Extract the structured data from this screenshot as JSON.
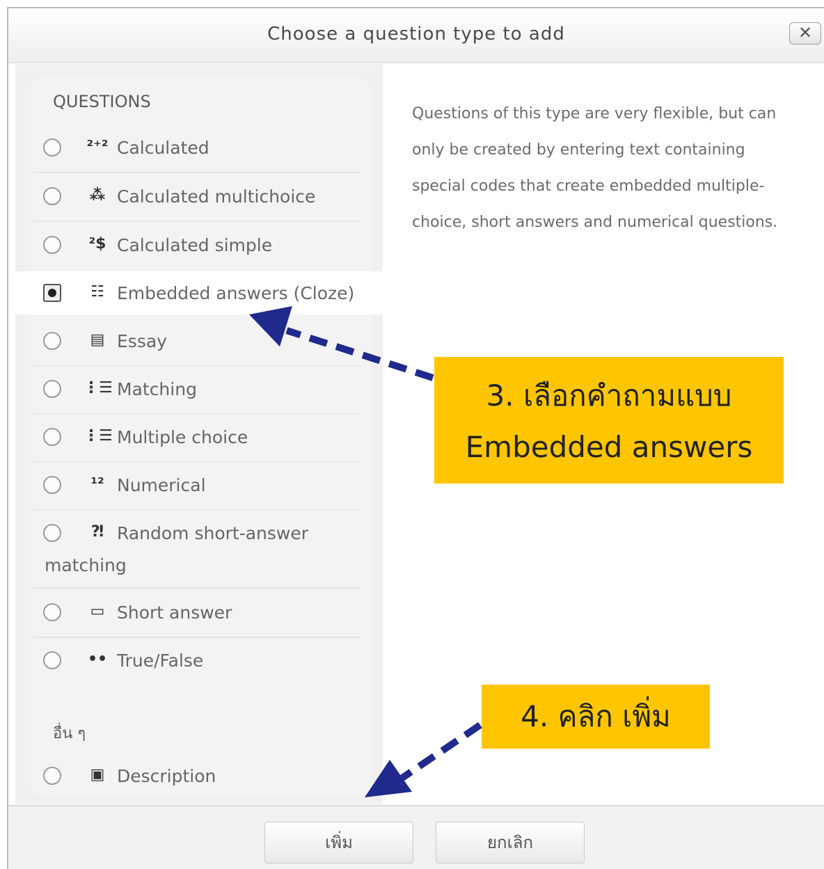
{
  "dialog": {
    "title": "Choose a question type to add",
    "close_icon": "close-icon",
    "close_glyph": "✕"
  },
  "left": {
    "section_questions": "QUESTIONS",
    "questions": [
      {
        "label": "Calculated",
        "icon": "calculated-icon",
        "glyph": "²⁺²",
        "selected": false
      },
      {
        "label": "Calculated multichoice",
        "icon": "calculated-multichoice-icon",
        "glyph": "⁂",
        "selected": false
      },
      {
        "label": "Calculated simple",
        "icon": "calculated-simple-icon",
        "glyph": "²$",
        "selected": false
      },
      {
        "label": "Embedded answers (Cloze)",
        "icon": "cloze-icon",
        "glyph": "☷",
        "selected": true
      },
      {
        "label": "Essay",
        "icon": "essay-icon",
        "glyph": "▤",
        "selected": false
      },
      {
        "label": "Matching",
        "icon": "matching-icon",
        "glyph": "⋮☰",
        "selected": false
      },
      {
        "label": "Multiple choice",
        "icon": "multiple-choice-icon",
        "glyph": "⋮☰",
        "selected": false
      },
      {
        "label": "Numerical",
        "icon": "numerical-icon",
        "glyph": "¹²",
        "selected": false
      },
      {
        "label": "Random short-answer",
        "label2": "matching",
        "icon": "random-short-answer-icon",
        "glyph": "⁈",
        "selected": false
      },
      {
        "label": "Short answer",
        "icon": "short-answer-icon",
        "glyph": "▭",
        "selected": false
      },
      {
        "label": "True/False",
        "icon": "true-false-icon",
        "glyph": "••",
        "selected": false
      }
    ],
    "section_other": "อื่น ๆ",
    "other": [
      {
        "label": "Description",
        "icon": "description-icon",
        "glyph": "▣",
        "selected": false
      }
    ]
  },
  "description": "Questions of this type are very flexible, but can only be created by entering text containing special codes that create embedded multiple-choice, short answers and numerical questions.",
  "footer": {
    "add_label": "เพิ่ม",
    "cancel_label": "ยกเลิก"
  },
  "callouts": {
    "step3_line1": "3. เลือกคำถามแบบ",
    "step3_line2": "Embedded answers",
    "step4": "4. คลิก เพิ่ม",
    "color": "#ffc600",
    "arrow_color": "#1f2a8c"
  }
}
